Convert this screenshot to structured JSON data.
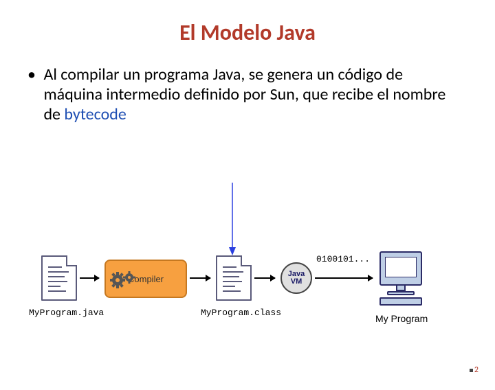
{
  "title": "El Modelo Java",
  "bullet": {
    "text_before": "Al compilar un programa Java, se genera un código de máquina intermedio definido por Sun, que recibe el nombre de ",
    "highlight": "bytecode"
  },
  "diagram": {
    "source_file": "MyProgram.java",
    "compiler_label": "Compiler",
    "class_file": "MyProgram.class",
    "jvm_line1": "Java",
    "jvm_line2": "VM",
    "binary_stream": "0100101...",
    "output_caption": "My Program"
  },
  "page_number": "2"
}
